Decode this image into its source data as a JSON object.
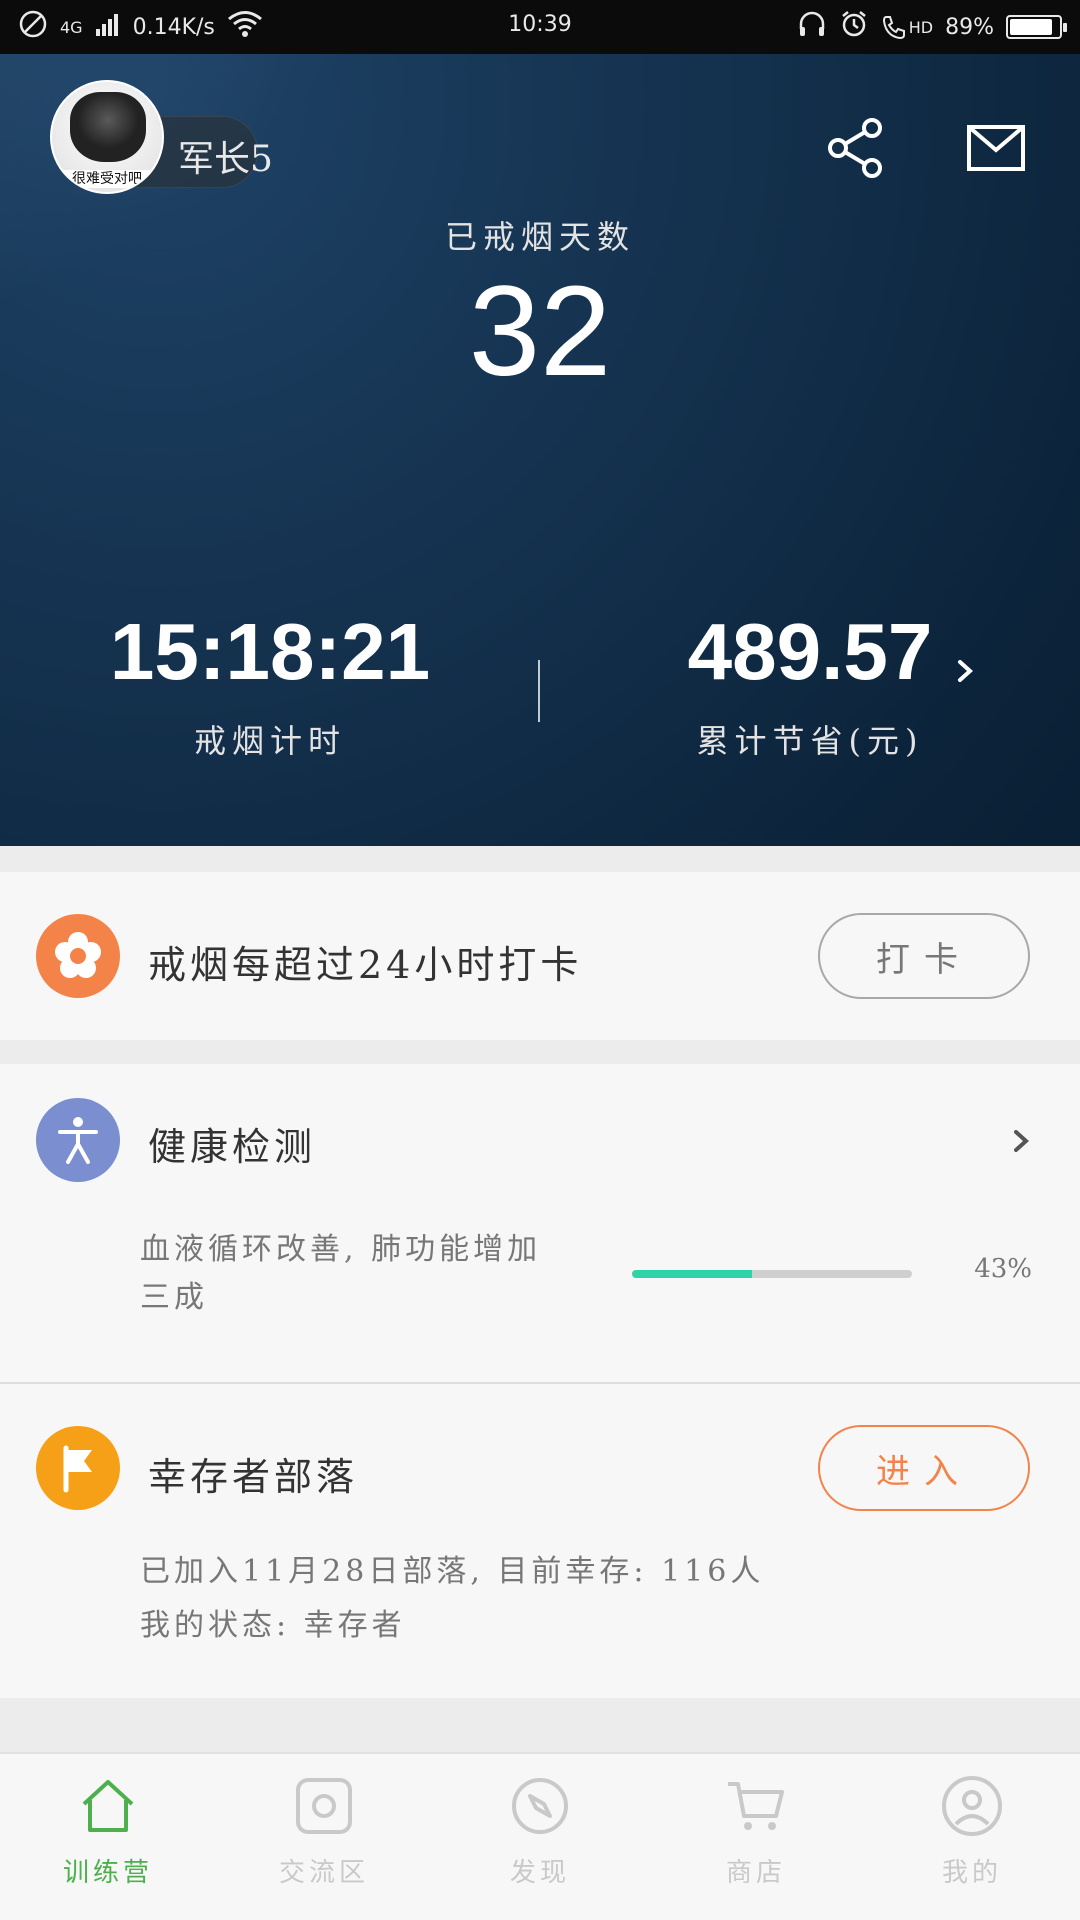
{
  "colors": {
    "accent_green": "#4db04c",
    "accent_orange": "#f4834a",
    "accent_amber": "#f5a017",
    "accent_blue": "#7b8fd0",
    "progress_green": "#2fd3a8",
    "inactive_nav": "#c9c9c9",
    "hero_bg": "#05080c"
  },
  "status_bar": {
    "network": "4G",
    "speed": "0.14K/s",
    "time": "10:39",
    "hd": "HD",
    "battery": "89%"
  },
  "profile": {
    "name": "军长5",
    "avatar_caption": "很难受对吧"
  },
  "hero": {
    "days_label": "已戒烟天数",
    "days_value": "32",
    "timer_value": "15:18:21",
    "timer_label": "戒烟计时",
    "saved_value": "489.57",
    "saved_label": "累计节省(元)"
  },
  "checkin": {
    "title": "戒烟每超过24小时打卡",
    "button": "打卡"
  },
  "health": {
    "title": "健康检测",
    "desc_line1": "血液循环改善, 肺功能增加",
    "desc_line2": "三成",
    "progress_percent": 43,
    "progress_text": "43%"
  },
  "tribe": {
    "title": "幸存者部落",
    "button": "进入",
    "desc_line1": "已加入11月28日部落, 目前幸存: 116人",
    "desc_line2": "我的状态: 幸存者"
  },
  "bottom_nav": {
    "items": [
      {
        "label": "训练营",
        "icon": "home-icon",
        "active": true
      },
      {
        "label": "交流区",
        "icon": "chat-square-icon",
        "active": false
      },
      {
        "label": "发现",
        "icon": "compass-icon",
        "active": false
      },
      {
        "label": "商店",
        "icon": "cart-icon",
        "active": false
      },
      {
        "label": "我的",
        "icon": "user-icon",
        "active": false
      }
    ]
  }
}
